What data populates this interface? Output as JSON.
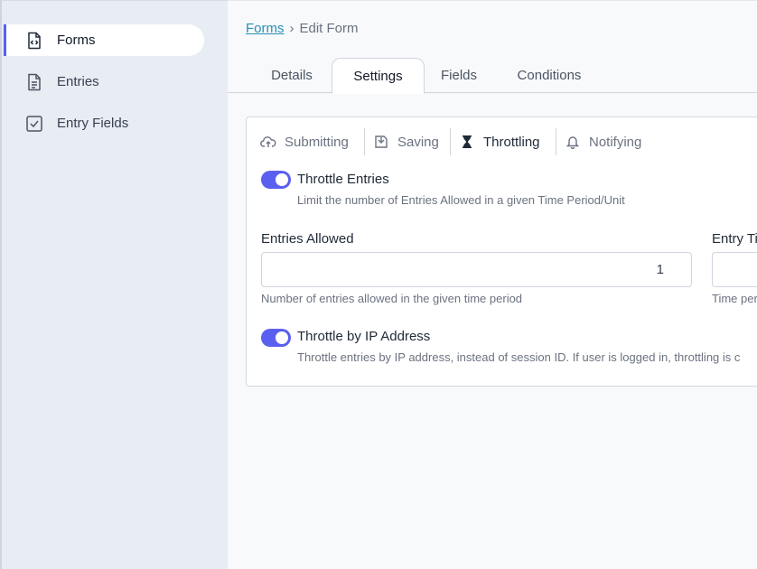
{
  "sidebar": {
    "items": [
      {
        "label": "Forms",
        "icon": "code-file-icon",
        "active": true
      },
      {
        "label": "Entries",
        "icon": "document-icon",
        "active": false
      },
      {
        "label": "Entry Fields",
        "icon": "checkbox-icon",
        "active": false
      }
    ]
  },
  "breadcrumb": {
    "root": "Forms",
    "separator": "›",
    "current": "Edit Form"
  },
  "tabs": [
    {
      "label": "Details"
    },
    {
      "label": "Settings",
      "active": true
    },
    {
      "label": "Fields"
    },
    {
      "label": "Conditions"
    }
  ],
  "subtabs": [
    {
      "label": "Submitting",
      "icon": "cloud-upload-icon"
    },
    {
      "label": "Saving",
      "icon": "save-icon"
    },
    {
      "label": "Throttling",
      "icon": "hourglass-icon",
      "active": true
    },
    {
      "label": "Notifying",
      "icon": "bell-icon"
    }
  ],
  "throttle_entries": {
    "label": "Throttle Entries",
    "help": "Limit the number of Entries Allowed in a given Time Period/Unit",
    "enabled": true
  },
  "entries_allowed": {
    "label": "Entries Allowed",
    "value": "1",
    "help": "Number of entries allowed in the given time period"
  },
  "entry_time": {
    "label": "Entry Ti",
    "help": "Time per"
  },
  "throttle_ip": {
    "label": "Throttle by IP Address",
    "help": "Throttle entries by IP address, instead of session ID. If user is logged in, throttling is c",
    "enabled": true
  },
  "colors": {
    "accent": "#5b5ff0",
    "link": "#2a8fb8",
    "sidebar_bg": "#e8ecf3"
  }
}
